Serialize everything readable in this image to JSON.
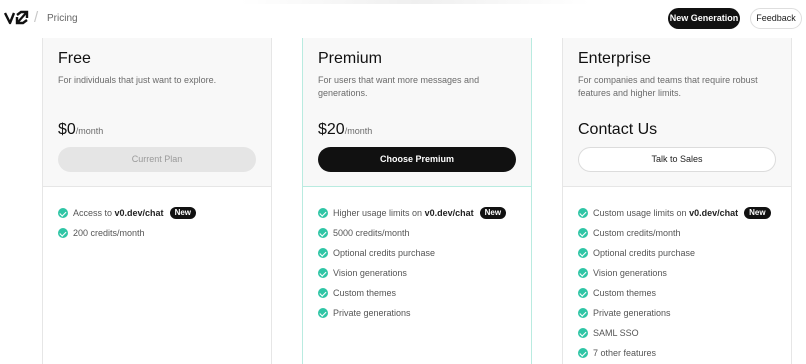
{
  "header": {
    "breadcrumb": "Pricing",
    "new_generation_label": "New Generation",
    "feedback_label": "Feedback"
  },
  "plans": [
    {
      "name": "Free",
      "description": "For individuals that just want to explore.",
      "price": "$0",
      "period": "/month",
      "button": "Current Plan",
      "features": [
        {
          "text": "Access to ",
          "bold": "v0.dev/chat",
          "badge": "New"
        },
        {
          "text": "200 credits/month"
        }
      ]
    },
    {
      "name": "Premium",
      "description": "For users that want more messages and generations.",
      "price": "$20",
      "period": "/month",
      "button": "Choose Premium",
      "features": [
        {
          "text": "Higher usage limits on ",
          "bold": "v0.dev/chat",
          "badge": "New"
        },
        {
          "text": "5000 credits/month"
        },
        {
          "text": "Optional credits purchase"
        },
        {
          "text": "Vision generations"
        },
        {
          "text": "Custom themes"
        },
        {
          "text": "Private generations"
        }
      ]
    },
    {
      "name": "Enterprise",
      "description": "For companies and teams that require robust features and higher limits.",
      "price": "Contact Us",
      "button": "Talk to Sales",
      "features": [
        {
          "text": "Custom usage limits on ",
          "bold": "v0.dev/chat",
          "badge": "New"
        },
        {
          "text": "Custom credits/month"
        },
        {
          "text": "Optional credits purchase"
        },
        {
          "text": "Vision generations"
        },
        {
          "text": "Custom themes"
        },
        {
          "text": "Private generations"
        },
        {
          "text": "SAML SSO"
        },
        {
          "text": "7 other features"
        }
      ]
    }
  ],
  "colors": {
    "accent": "#2fc5a5",
    "dark_button": "#111111",
    "premium_border": "#b9ebe0"
  }
}
